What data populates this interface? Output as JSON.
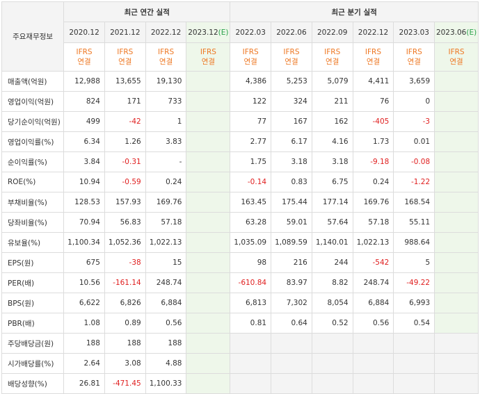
{
  "header": {
    "row_label": "주요재무정보",
    "annual_group": "최근 연간 실적",
    "quarter_group": "최근 분기 실적",
    "annual_periods": [
      "2020.12",
      "2021.12",
      "2022.12",
      "2023.12"
    ],
    "annual_estimate_mark": "(E)",
    "quarter_periods": [
      "2022.03",
      "2022.06",
      "2022.09",
      "2022.12",
      "2023.03",
      "2023.06"
    ],
    "quarter_estimate_mark": "(E)",
    "accounting_line1": "IFRS",
    "accounting_line2": "연결"
  },
  "rows": [
    {
      "label": "매출액(억원)",
      "annual": [
        "12,988",
        "13,655",
        "19,130",
        ""
      ],
      "quarter": [
        "4,386",
        "5,253",
        "5,079",
        "4,411",
        "3,659",
        ""
      ]
    },
    {
      "label": "영업이익(억원)",
      "annual": [
        "824",
        "171",
        "733",
        ""
      ],
      "quarter": [
        "122",
        "324",
        "211",
        "76",
        "0",
        ""
      ]
    },
    {
      "label": "당기순이익(억원)",
      "annual": [
        "499",
        "-42",
        "1",
        ""
      ],
      "quarter": [
        "77",
        "167",
        "162",
        "-405",
        "-3",
        ""
      ]
    },
    {
      "label": "영업이익률(%)",
      "annual": [
        "6.34",
        "1.26",
        "3.83",
        ""
      ],
      "quarter": [
        "2.77",
        "6.17",
        "4.16",
        "1.73",
        "0.01",
        ""
      ]
    },
    {
      "label": "순이익률(%)",
      "annual": [
        "3.84",
        "-0.31",
        "-",
        ""
      ],
      "quarter": [
        "1.75",
        "3.18",
        "3.18",
        "-9.18",
        "-0.08",
        ""
      ]
    },
    {
      "label": "ROE(%)",
      "annual": [
        "10.94",
        "-0.59",
        "0.24",
        ""
      ],
      "quarter": [
        "-0.14",
        "0.83",
        "6.75",
        "0.24",
        "-1.22",
        ""
      ]
    },
    {
      "label": "부채비율(%)",
      "annual": [
        "128.53",
        "157.93",
        "169.76",
        ""
      ],
      "quarter": [
        "163.45",
        "175.44",
        "177.14",
        "169.76",
        "168.54",
        ""
      ]
    },
    {
      "label": "당좌비율(%)",
      "annual": [
        "70.94",
        "56.83",
        "57.18",
        ""
      ],
      "quarter": [
        "63.28",
        "59.01",
        "57.64",
        "57.18",
        "55.11",
        ""
      ]
    },
    {
      "label": "유보율(%)",
      "annual": [
        "1,100.34",
        "1,052.36",
        "1,022.13",
        ""
      ],
      "quarter": [
        "1,035.09",
        "1,089.59",
        "1,140.01",
        "1,022.13",
        "988.64",
        ""
      ]
    },
    {
      "label": "EPS(원)",
      "annual": [
        "675",
        "-38",
        "15",
        ""
      ],
      "quarter": [
        "98",
        "216",
        "244",
        "-542",
        "5",
        ""
      ]
    },
    {
      "label": "PER(배)",
      "annual": [
        "10.56",
        "-161.14",
        "248.74",
        ""
      ],
      "quarter": [
        "-610.84",
        "83.97",
        "8.82",
        "248.74",
        "-49.22",
        ""
      ]
    },
    {
      "label": "BPS(원)",
      "annual": [
        "6,622",
        "6,826",
        "6,884",
        ""
      ],
      "quarter": [
        "6,813",
        "7,302",
        "8,054",
        "6,884",
        "6,993",
        ""
      ]
    },
    {
      "label": "PBR(배)",
      "annual": [
        "1.08",
        "0.89",
        "0.56",
        ""
      ],
      "quarter": [
        "0.81",
        "0.64",
        "0.52",
        "0.56",
        "0.54",
        ""
      ]
    },
    {
      "label": "주당배당금(원)",
      "annual": [
        "188",
        "188",
        "188",
        ""
      ],
      "quarter": [
        null,
        null,
        null,
        null,
        null,
        null
      ]
    },
    {
      "label": "시가배당률(%)",
      "annual": [
        "2.64",
        "3.08",
        "4.88",
        ""
      ],
      "quarter": [
        null,
        null,
        null,
        null,
        null,
        null
      ]
    },
    {
      "label": "배당성향(%)",
      "annual": [
        "26.81",
        "-471.45",
        "1,100.33",
        ""
      ],
      "quarter": [
        null,
        null,
        null,
        null,
        null,
        null
      ]
    }
  ],
  "colors": {
    "negative": "#e02020",
    "accounting": "#ee7722",
    "estimate_bg": "#eef7ea",
    "estimate_mark": "#2aa24a",
    "header_bg": "#f4f4f4"
  }
}
